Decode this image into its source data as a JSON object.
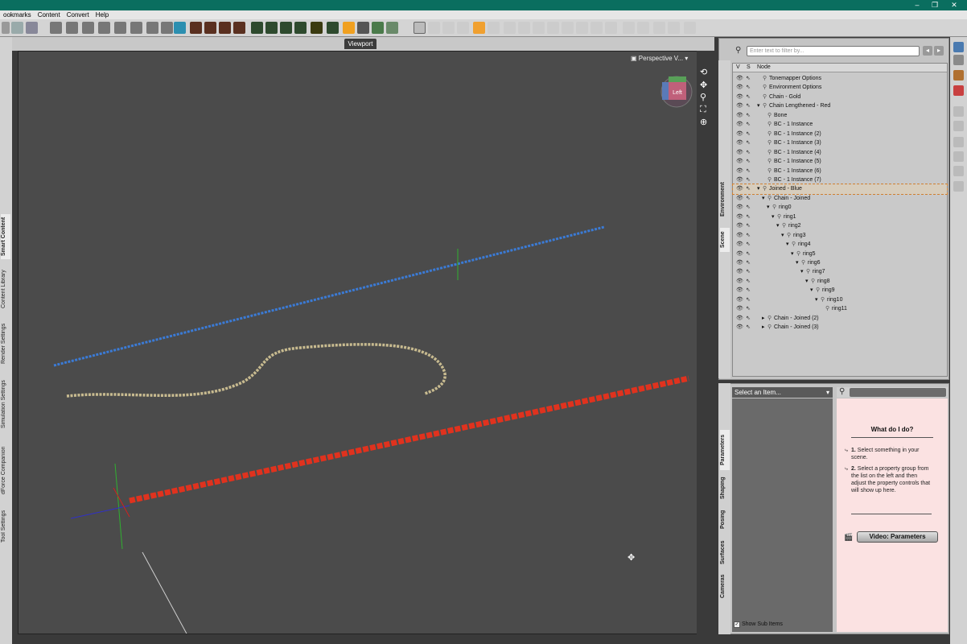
{
  "menu": [
    "ookmarks",
    "Content",
    "Convert",
    "Help"
  ],
  "viewport": {
    "tab_label": "Viewport",
    "camera_label": "Perspective V...",
    "cube_label": "Left"
  },
  "left_tabs": [
    "Smart Content",
    "Content Library",
    "Render Settings",
    "Simulation Settings",
    "dForce Companion",
    "Tool Settings"
  ],
  "scene": {
    "filter_placeholder": "Enter text to filter by...",
    "columns": {
      "v": "V",
      "s": "S",
      "node": "Node"
    },
    "side_tabs": [
      "Environment",
      "Scene"
    ],
    "nodes": [
      {
        "label": "Tonemapper Options",
        "depth": 0,
        "highlight": false
      },
      {
        "label": "Environment Options",
        "depth": 0,
        "highlight": false
      },
      {
        "label": "Chain - Gold",
        "depth": 0,
        "highlight": false
      },
      {
        "label": "Chain Lengthened - Red",
        "depth": 0,
        "highlight": false
      },
      {
        "label": "Bone",
        "depth": 1,
        "highlight": false
      },
      {
        "label": "BC - 1 Instance",
        "depth": 1,
        "highlight": false
      },
      {
        "label": "BC - 1 Instance (2)",
        "depth": 1,
        "highlight": false
      },
      {
        "label": "BC - 1 Instance (3)",
        "depth": 1,
        "highlight": false
      },
      {
        "label": "BC - 1 Instance (4)",
        "depth": 1,
        "highlight": false
      },
      {
        "label": "BC - 1 Instance (5)",
        "depth": 1,
        "highlight": false
      },
      {
        "label": "BC - 1 Instance (6)",
        "depth": 1,
        "highlight": false
      },
      {
        "label": "BC - 1 Instance (7)",
        "depth": 1,
        "highlight": false
      },
      {
        "label": "Joined - Blue",
        "depth": 0,
        "highlight": true
      },
      {
        "label": "Chain - Joined",
        "depth": 1,
        "highlight": false
      },
      {
        "label": "ring0",
        "depth": 2,
        "highlight": false
      },
      {
        "label": "ring1",
        "depth": 3,
        "highlight": false
      },
      {
        "label": "ring2",
        "depth": 4,
        "highlight": false
      },
      {
        "label": "ring3",
        "depth": 5,
        "highlight": false
      },
      {
        "label": "ring4",
        "depth": 6,
        "highlight": false
      },
      {
        "label": "ring5",
        "depth": 7,
        "highlight": false
      },
      {
        "label": "ring6",
        "depth": 8,
        "highlight": false
      },
      {
        "label": "ring7",
        "depth": 9,
        "highlight": false
      },
      {
        "label": "ring8",
        "depth": 10,
        "highlight": false
      },
      {
        "label": "ring9",
        "depth": 11,
        "highlight": false
      },
      {
        "label": "ring10",
        "depth": 12,
        "highlight": false
      },
      {
        "label": "ring11",
        "depth": 13,
        "highlight": false
      },
      {
        "label": "Chain - Joined (2)",
        "depth": 1,
        "highlight": false
      },
      {
        "label": "Chain - Joined (3)",
        "depth": 1,
        "highlight": false
      }
    ]
  },
  "parameters": {
    "side_tabs": [
      "Parameters",
      "Shaping",
      "Posing",
      "Surfaces",
      "Cameras"
    ],
    "select_label": "Select an Item...",
    "show_sub_items": "Show Sub Items",
    "help_title": "What do I do?",
    "step1_num": "1.",
    "step1_text": "Select something in your scene.",
    "step2_num": "2.",
    "step2_text": "Select a property group from the list on the left and then adjust the property controls that will show up here.",
    "video_button": "Video: Parameters"
  },
  "colors": {
    "titlebar": "#0a6e5f",
    "chain_blue": "#3b7bd6",
    "chain_gold": "#c8bb90",
    "chain_red": "#e0321e",
    "help_bg": "#fbe2e2"
  }
}
